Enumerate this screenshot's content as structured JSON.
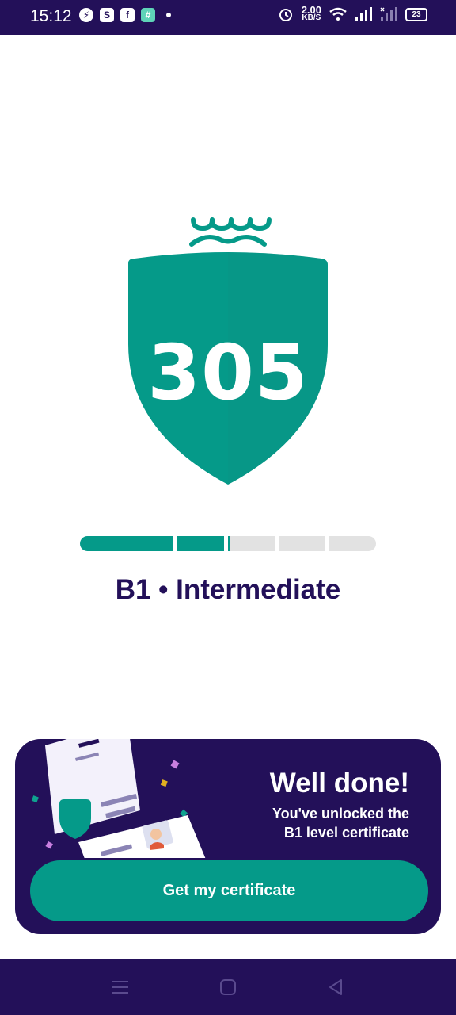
{
  "status_bar": {
    "time": "15:12",
    "network_speed_value": "2.00",
    "network_speed_unit": "KB/S",
    "battery": "23",
    "notification_icons": [
      "messenger-icon",
      "shop-icon",
      "facebook-icon",
      "app-icon"
    ]
  },
  "score": {
    "value": "305",
    "level_progress": 0.5
  },
  "level": {
    "label": "B1 • Intermediate"
  },
  "promo": {
    "title": "Well done!",
    "subtitle_line1": "You've unlocked the",
    "subtitle_line2": "B1 level certificate",
    "cta_label": "Get my certificate"
  },
  "colors": {
    "brand_dark": "#231059",
    "teal": "#059a89",
    "track_gray": "#e2e2e2"
  }
}
